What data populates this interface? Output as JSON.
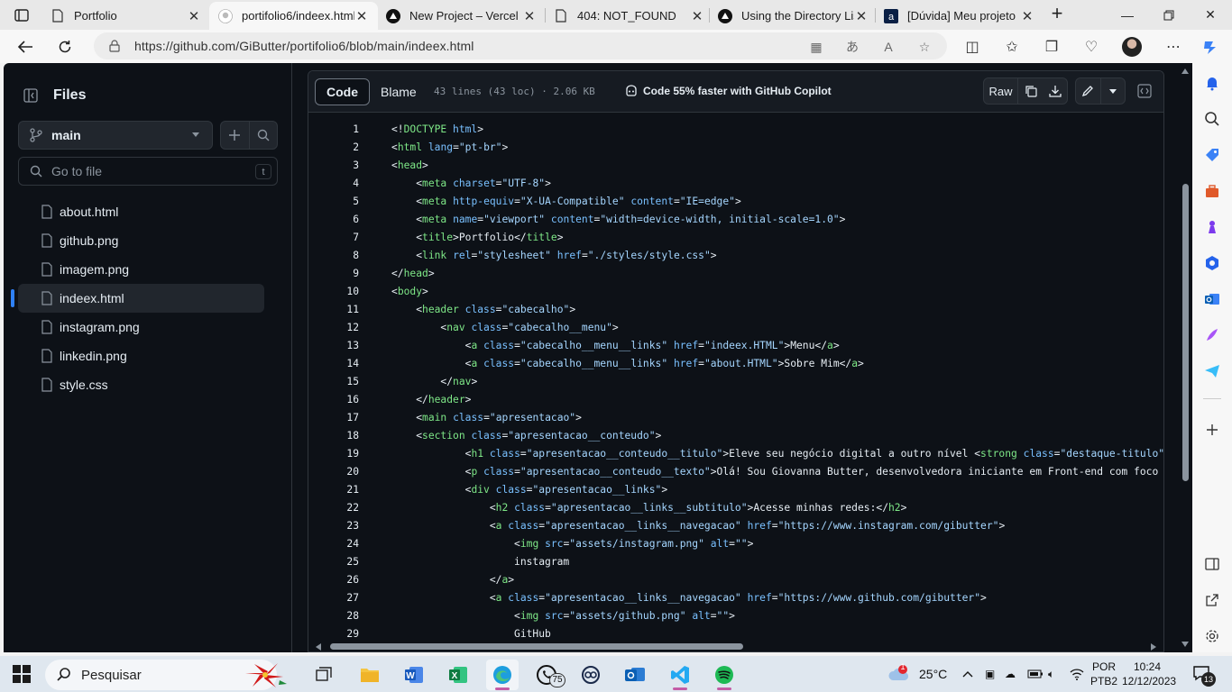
{
  "browser": {
    "tabs": [
      {
        "title": "Portfolio",
        "icon": "doc-icon",
        "active": false
      },
      {
        "title": "portifolio6/indeex.html",
        "icon": "github-icon",
        "active": true
      },
      {
        "title": "New Project – Vercel",
        "icon": "vercel-icon",
        "active": false
      },
      {
        "title": "404: NOT_FOUND",
        "icon": "doc-icon",
        "active": false
      },
      {
        "title": "Using the Directory Lis",
        "icon": "vercel-icon",
        "active": false
      },
      {
        "title": "[Dúvida] Meu projeto",
        "icon": "alura-icon",
        "active": false
      }
    ],
    "url": "https://github.com/GiButter/portifolio6/blob/main/indeex.html"
  },
  "files_panel": {
    "title": "Files",
    "branch": "main",
    "goto_placeholder": "Go to file",
    "goto_shortcut": "t",
    "files": [
      "about.html",
      "github.png",
      "imagem.png",
      "indeex.html",
      "instagram.png",
      "linkedin.png",
      "style.css"
    ],
    "selected_file": "indeex.html"
  },
  "code_header": {
    "code_tab": "Code",
    "blame_tab": "Blame",
    "line_info": "43 lines (43 loc) · 2.06 KB",
    "copilot_text": "Code 55% faster with GitHub Copilot",
    "raw_label": "Raw"
  },
  "code_lines": [
    "<!DOCTYPE html>",
    "<html lang=\"pt-br\">",
    "<head>",
    "    <meta charset=\"UTF-8\">",
    "    <meta http-equiv=\"X-UA-Compatible\" content=\"IE=edge\">",
    "    <meta name=\"viewport\" content=\"width=device-width, initial-scale=1.0\">",
    "    <title>Portfolio</title>",
    "    <link rel=\"stylesheet\" href=\"./styles/style.css\">",
    "</head>",
    "<body>",
    "    <header class=\"cabecalho\">",
    "        <nav class=\"cabecalho__menu\">",
    "            <a class=\"cabecalho__menu__links\" href=\"indeex.HTML\">Menu</a>",
    "            <a class=\"cabecalho__menu__links\" href=\"about.HTML\">Sobre Mim</a>",
    "        </nav>",
    "    </header>",
    "    <main class=\"apresentacao\">",
    "    <section class=\"apresentacao__conteudo\">",
    "            <h1 class=\"apresentacao__conteudo__titulo\">Eleve seu negócio digital a outro nível <strong class=\"destaque-titulo\">com",
    "            <p class=\"apresentacao__conteudo__texto\">Olá! Sou Giovanna Butter, desenvolvedora iniciante em Front-end com foco em <",
    "            <div class=\"apresentacao__links\">",
    "                <h2 class=\"apresentacao__links__subtitulo\">Acesse minhas redes:</h2>",
    "                <a class=\"apresentacao__links__navegacao\" href=\"https://www.instagram.com/gibutter\">",
    "                    <img src=\"assets/instagram.png\" alt=\"\">",
    "                    instagram",
    "                </a>",
    "                <a class=\"apresentacao__links__navegacao\" href=\"https://www.github.com/gibutter\">",
    "                    <img src=\"assets/github.png\" alt=\"\">",
    "                    GitHub"
  ],
  "taskbar": {
    "search_label": "Pesquisar",
    "whatsapp_badge": "75",
    "weather": "25°C",
    "weather_badge": "1",
    "lang_top": "POR",
    "lang_bottom": "PTB2",
    "time": "10:24",
    "date": "12/12/2023",
    "notif_count": "13"
  },
  "colors": {
    "tag": "#7ee787",
    "attr": "#79c0ff",
    "string": "#a5d6ff",
    "text": "#e6edf3",
    "accent": "#2f81f7"
  }
}
